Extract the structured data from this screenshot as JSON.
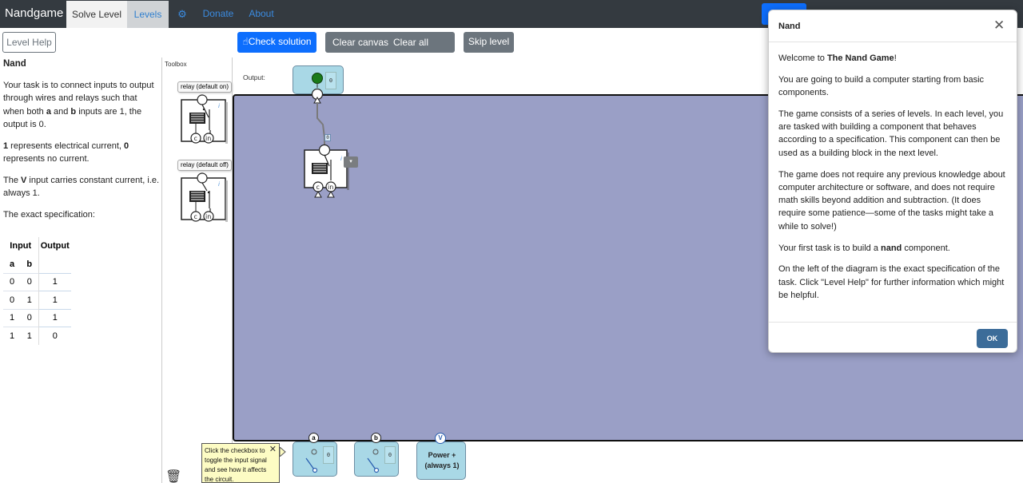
{
  "nav": {
    "brand": "Nandgame",
    "tab_solve": "Solve Level",
    "tab_levels": "Levels",
    "link_donate": "Donate",
    "link_about": "About"
  },
  "toolbar": {
    "level_help": "Level Help",
    "check_solution": "Check solution",
    "clear_canvas": "Clear canvas",
    "clear_all_levels": "Clear all levels",
    "skip_level": "Skip level"
  },
  "left_panel": {
    "title": "Nand",
    "p1_part1": "Your task is to connect inputs to output through wires and relays such that when both ",
    "p1_a": "a",
    "p1_part2": " and ",
    "p1_b": "b",
    "p1_part3": " inputs are 1, the output is 0.",
    "p2_one": "1",
    "p2_part1": " represents electrical current, ",
    "p2_zero": "0",
    "p2_part2": " represents no current.",
    "p3_part1": "The ",
    "p3_v": "V",
    "p3_part2": " input carries constant current, i.e. always 1.",
    "p4": "The exact specification:",
    "table": {
      "header_input": "Input",
      "header_output": "Output",
      "col_a": "a",
      "col_b": "b",
      "rows": [
        [
          "0",
          "0",
          "1"
        ],
        [
          "0",
          "1",
          "1"
        ],
        [
          "1",
          "0",
          "1"
        ],
        [
          "1",
          "1",
          "0"
        ]
      ]
    }
  },
  "toolbox": {
    "title": "Toolbox",
    "relay_on_label": "relay (default on)",
    "relay_off_label": "relay (default off)",
    "pin_c": "c",
    "pin_in": "in",
    "info": "i"
  },
  "canvas": {
    "output_label": "Output:",
    "output_value": "0",
    "wire_value": "0",
    "input_a_label": "a",
    "input_a_value": "0",
    "input_b_label": "b",
    "input_b_value": "0",
    "power_label": "V",
    "power_line1": "Power +",
    "power_line2": "(always 1)"
  },
  "tooltip": {
    "text": "Click the checkbox to toggle the input signal and see how it affects the circuit."
  },
  "modal": {
    "title": "Nand",
    "welcome_pre": "Welcome to ",
    "welcome_bold": "The Nand Game",
    "welcome_post": "!",
    "p2": "You are going to build a computer starting from basic components.",
    "p3": "The game consists of a series of levels. In each level, you are tasked with building a component that behaves according to a specification. This component can then be used as a building block in the next level.",
    "p4": "The game does not require any previous knowledge about computer architecture or software, and does not require math skills beyond addition and subtraction. (It does require some patience—some of the tasks might take a while to solve!)",
    "p5_pre": "Your first task is to build a ",
    "p5_bold": "nand",
    "p5_post": " component.",
    "p6": "On the left of the diagram is the exact specification of the task. Click \"Level Help\" for further information which might be helpful.",
    "ok": "OK"
  }
}
